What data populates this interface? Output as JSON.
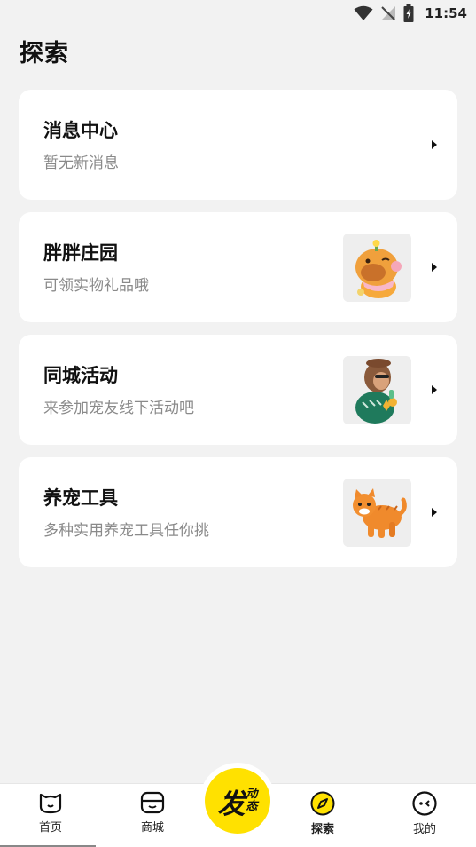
{
  "status_bar": {
    "time": "11:54"
  },
  "page": {
    "title": "探索"
  },
  "cards": [
    {
      "title": "消息中心",
      "subtitle": "暂无新消息"
    },
    {
      "title": "胖胖庄园",
      "subtitle": "可领实物礼品哦",
      "image": "capybara-mascot-image"
    },
    {
      "title": "同城活动",
      "subtitle": "来参加宠友线下活动吧",
      "image": "monkey-mascot-image"
    },
    {
      "title": "养宠工具",
      "subtitle": "多种实用养宠工具任你挑",
      "image": "orange-cat-image"
    }
  ],
  "tab_bar": {
    "home": "首页",
    "mall": "商城",
    "publish_big": "发",
    "publish_small_1": "动",
    "publish_small_2": "态",
    "explore": "探索",
    "mine": "我的",
    "active": "explore"
  },
  "colors": {
    "accent": "#ffe100",
    "background": "#f2f2f2",
    "card": "#ffffff",
    "subtitle": "#8a8a8a"
  }
}
